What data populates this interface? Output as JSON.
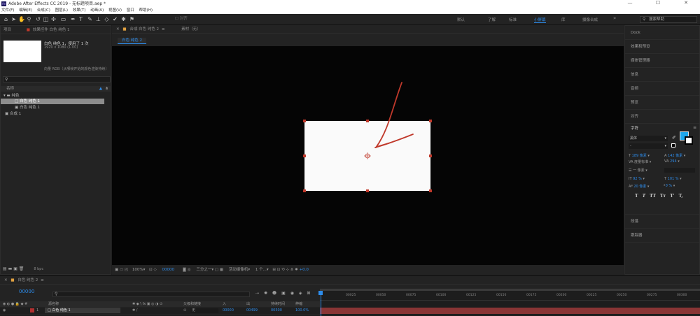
{
  "window": {
    "title": "Adobe After Effects CC 2019 - 无标题项目.aep *",
    "app_icon": "Ae",
    "minimize": "—",
    "maximize": "☐",
    "close": "✕"
  },
  "menu": [
    "文件(F)",
    "编辑(E)",
    "合成(C)",
    "图层(L)",
    "效果(T)",
    "动画(A)",
    "视图(V)",
    "窗口",
    "帮助(H)"
  ],
  "toolbar": {
    "align_label": "对齐",
    "workspaces": [
      "默认",
      "了解",
      "标准",
      "小屏幕",
      "库"
    ],
    "active_workspace": "小屏幕",
    "extra_workspace": "摄像合成",
    "search_placeholder": "搜索帮助"
  },
  "project": {
    "tab_project": "项目",
    "tab_effects": "效果控件 白色 纯色 1",
    "item_name": "白色 纯色 1",
    "item_usage": "，使用了 1 次",
    "item_dims": "1920 x 1080 (1.00)",
    "hint": "向量 RGB（从哪帧开始的颜色渲染持续）",
    "col_name": "名称",
    "tree": [
      "纯色",
      "白色 纯色 1",
      "白色 纯色 1",
      "合成 1"
    ],
    "bpc": "8 bpc"
  },
  "composition": {
    "tab_label": "合成 白色 纯色 2",
    "footage_label": "素材（无）",
    "subtab": "白色 纯色 2",
    "zoom": "100%",
    "timecode": "00000",
    "resolution": "三分之一",
    "camera": "活动摄像机",
    "views": "1 个...",
    "exposure": "+0.0"
  },
  "right_panel": {
    "items_top": [
      "Dock",
      "效果和预设",
      "媒体管理器",
      "信息",
      "音频",
      "预览",
      "对齐"
    ],
    "character_title": "字符",
    "font_name": "黑体",
    "font_style": "-",
    "font_size": "189 像素",
    "leading": "142 像素",
    "kerning": "度量标准",
    "tracking": "294",
    "stroke_width": "一 像素",
    "vert_scale": "92 %",
    "horiz_scale": "101 %",
    "baseline_shift": "20 像素",
    "tsume": "0 %",
    "style_buttons": [
      "T",
      "T",
      "TT",
      "Tт",
      "T'",
      "T,"
    ],
    "items_bottom": [
      "段落",
      "跟踪器"
    ],
    "fill_color": "#1ea7ec"
  },
  "timeline": {
    "tab_label": "白色 纯色 2",
    "timecode": "00000",
    "columns": [
      "源名称",
      "父级和链接",
      "入",
      "出",
      "持续时间",
      "伸缩"
    ],
    "layer_number": "1",
    "layer_name": "白色 纯色 1",
    "parent_value": "无",
    "in_value": "00000",
    "out_value": "00499",
    "duration_value": "00500",
    "stretch_value": "100.0%",
    "ruler_ticks": [
      "00025",
      "00050",
      "00075",
      "00100",
      "00125",
      "00150",
      "00175",
      "00200",
      "00225",
      "00250",
      "00275",
      "00300"
    ]
  }
}
